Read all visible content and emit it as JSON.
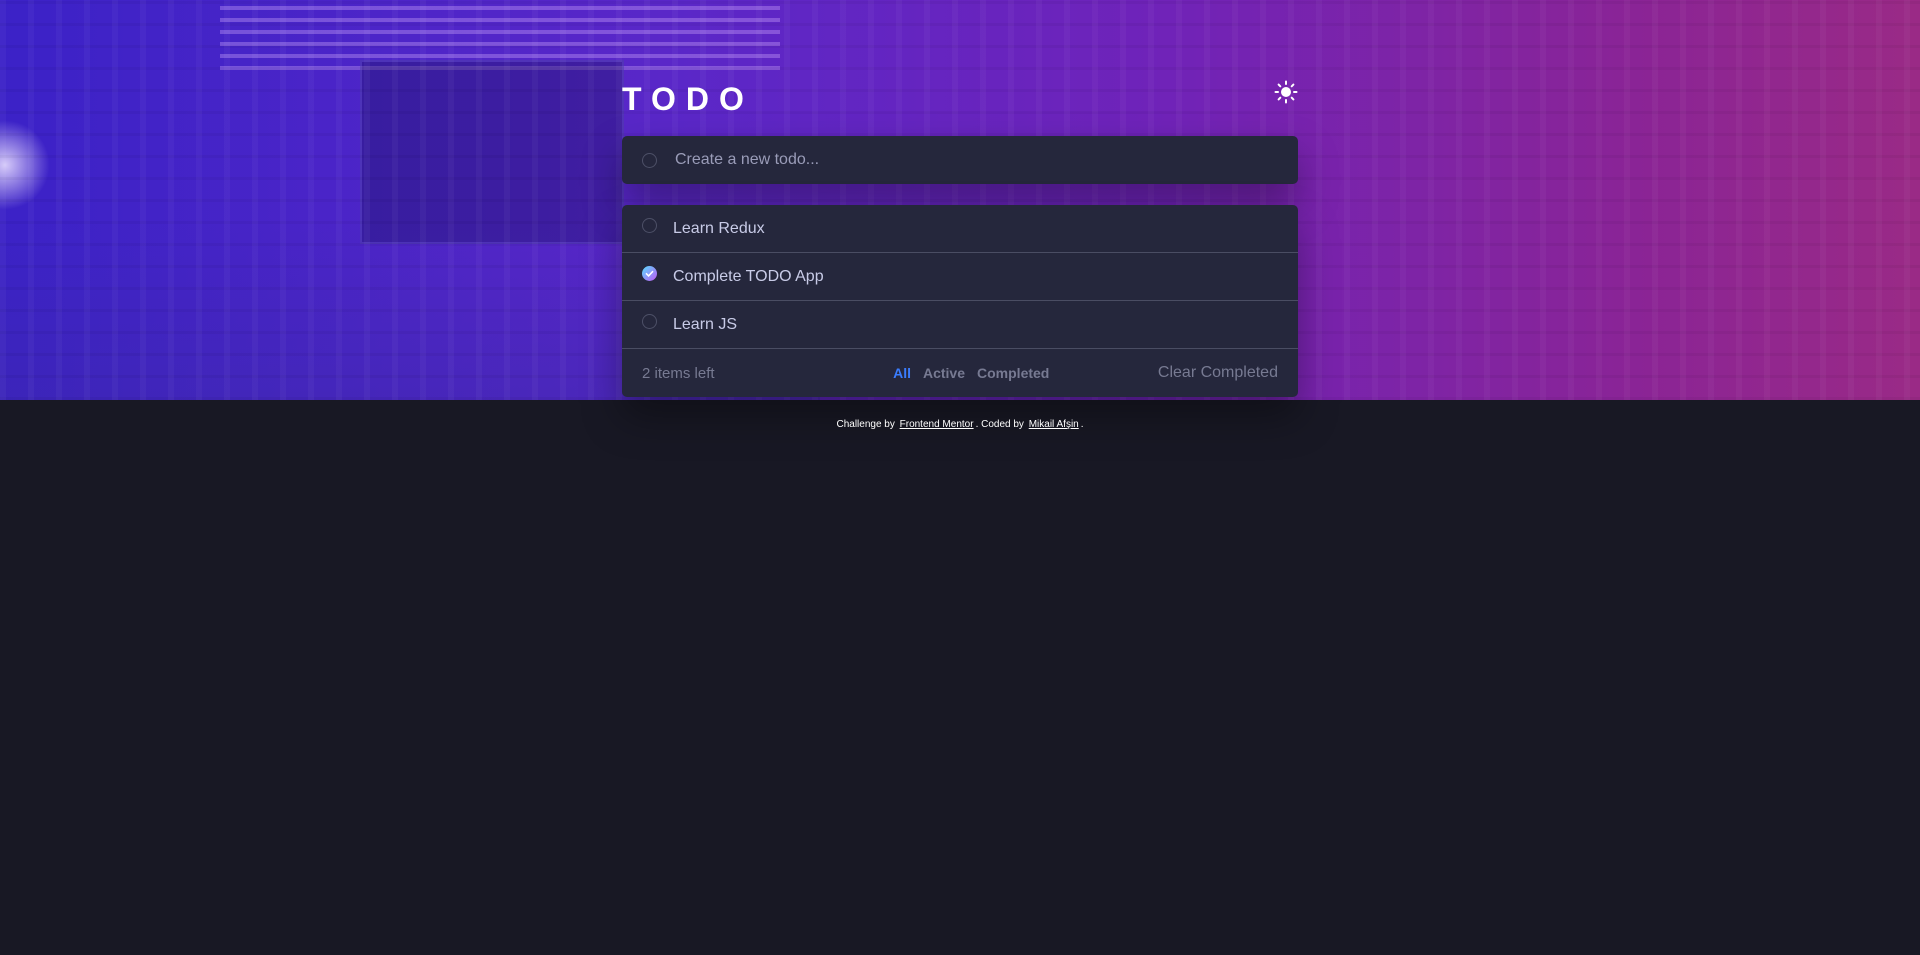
{
  "app": {
    "title": "TODO",
    "theme_toggle_icon": "sun-icon",
    "accent_color": "#3a7cfd",
    "check_gradient": [
      "#57ddff",
      "#c058f3"
    ]
  },
  "new_todo": {
    "placeholder": "Create a new todo..."
  },
  "todos": [
    {
      "label": "Learn Redux",
      "completed": false
    },
    {
      "label": "Complete TODO App",
      "completed": true
    },
    {
      "label": "Learn JS",
      "completed": false
    }
  ],
  "footer": {
    "items_left": "2 items left",
    "filters": {
      "all": "All",
      "active": "Active",
      "completed": "Completed"
    },
    "active_filter": "All",
    "clear_completed": "Clear Completed"
  },
  "attribution": {
    "prefix": "Challenge by",
    "challenge_link": "Frontend Mentor",
    "middle": ". Coded by",
    "author_link": "Mikail Afşin",
    "suffix": "."
  }
}
